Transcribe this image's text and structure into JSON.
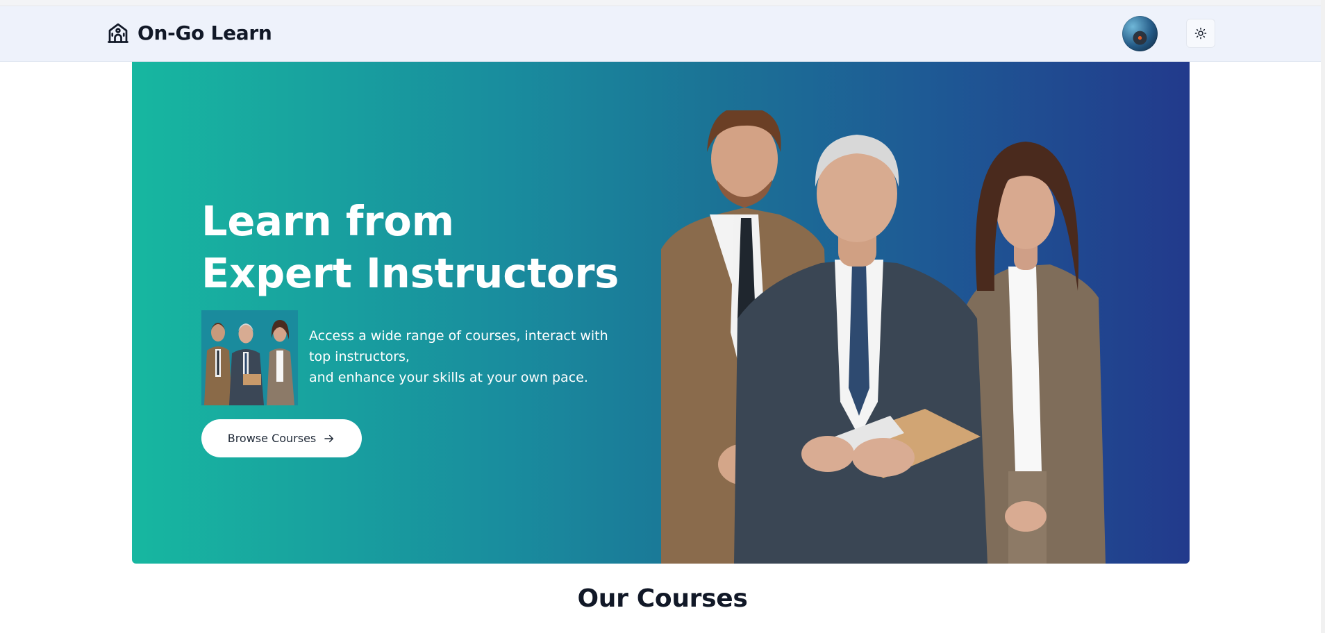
{
  "header": {
    "brand": "On-Go Learn",
    "logo_icon": "school-building-icon",
    "avatar_icon": "user-avatar",
    "theme_toggle_icon": "sun-icon"
  },
  "hero": {
    "title_line1": "Learn from",
    "title_line2": "Expert Instructors",
    "description_line1": "Access a wide range of courses, interact with top instructors,",
    "description_line2": "and enhance your skills at your own pace.",
    "cta_label": "Browse Courses",
    "cta_icon": "arrow-right-icon",
    "gradient_start": "#17b7a0",
    "gradient_end": "#223a8c"
  },
  "courses": {
    "heading": "Our Courses"
  }
}
